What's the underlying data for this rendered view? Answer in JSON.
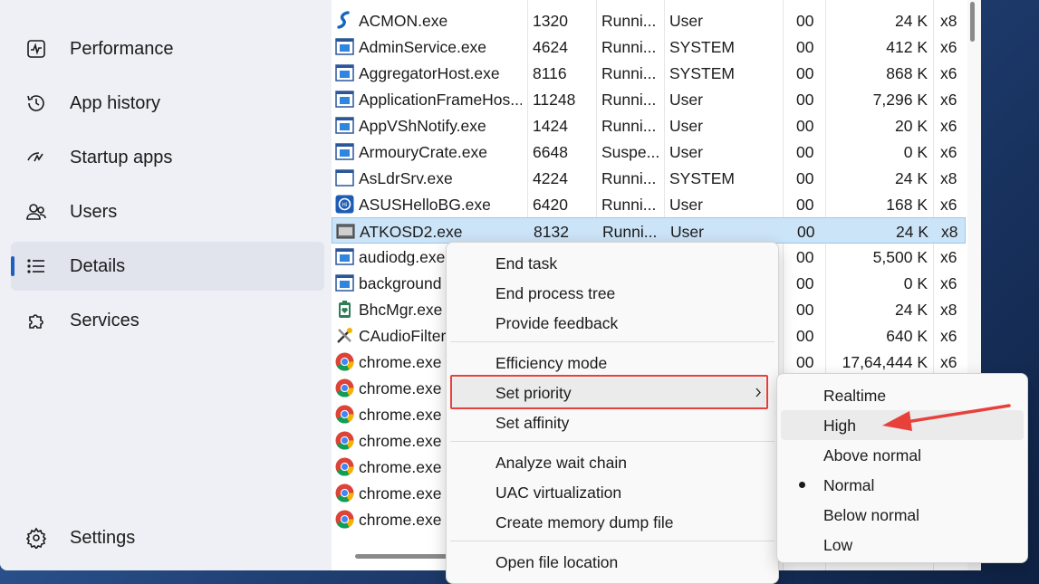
{
  "sidebar": {
    "items": [
      {
        "label": "Performance",
        "icon": "performance-icon",
        "active": false
      },
      {
        "label": "App history",
        "icon": "history-icon",
        "active": false
      },
      {
        "label": "Startup apps",
        "icon": "startup-icon",
        "active": false
      },
      {
        "label": "Users",
        "icon": "users-icon",
        "active": false
      },
      {
        "label": "Details",
        "icon": "list-icon",
        "active": true
      },
      {
        "label": "Services",
        "icon": "puzzle-icon",
        "active": false
      }
    ],
    "settings_label": "Settings"
  },
  "processes": [
    {
      "name": "ACMON.exe",
      "pid": "1320",
      "status": "Runni...",
      "user": "User",
      "cpu": "00",
      "mem": "24 K",
      "arch": "x8",
      "icon": "acmon-icon"
    },
    {
      "name": "AdminService.exe",
      "pid": "4624",
      "status": "Runni...",
      "user": "SYSTEM",
      "cpu": "00",
      "mem": "412 K",
      "arch": "x6",
      "icon": "exe-icon"
    },
    {
      "name": "AggregatorHost.exe",
      "pid": "8116",
      "status": "Runni...",
      "user": "SYSTEM",
      "cpu": "00",
      "mem": "868 K",
      "arch": "x6",
      "icon": "exe-icon"
    },
    {
      "name": "ApplicationFrameHos...",
      "pid": "11248",
      "status": "Runni...",
      "user": "User",
      "cpu": "00",
      "mem": "7,296 K",
      "arch": "x6",
      "icon": "exe-icon"
    },
    {
      "name": "AppVShNotify.exe",
      "pid": "1424",
      "status": "Runni...",
      "user": "User",
      "cpu": "00",
      "mem": "20 K",
      "arch": "x6",
      "icon": "exe-icon"
    },
    {
      "name": "ArmouryCrate.exe",
      "pid": "6648",
      "status": "Suspe...",
      "user": "User",
      "cpu": "00",
      "mem": "0 K",
      "arch": "x6",
      "icon": "exe-icon"
    },
    {
      "name": "AsLdrSrv.exe",
      "pid": "4224",
      "status": "Runni...",
      "user": "SYSTEM",
      "cpu": "00",
      "mem": "24 K",
      "arch": "x8",
      "icon": "window-icon"
    },
    {
      "name": "ASUSHelloBG.exe",
      "pid": "6420",
      "status": "Runni...",
      "user": "User",
      "cpu": "00",
      "mem": "168 K",
      "arch": "x6",
      "icon": "asus-hello-icon"
    },
    {
      "name": "ATKOSD2.exe",
      "pid": "8132",
      "status": "Runni...",
      "user": "User",
      "cpu": "00",
      "mem": "24 K",
      "arch": "x8",
      "icon": "atk-osd-icon",
      "selected": true
    },
    {
      "name": "audiodg.exe",
      "pid": "",
      "status": "",
      "user": "",
      "cpu": "00",
      "mem": "5,500 K",
      "arch": "x6",
      "icon": "exe-icon"
    },
    {
      "name": "background",
      "pid": "",
      "status": "",
      "user": "",
      "cpu": "00",
      "mem": "0 K",
      "arch": "x6",
      "icon": "exe-icon"
    },
    {
      "name": "BhcMgr.exe",
      "pid": "",
      "status": "",
      "user": "",
      "cpu": "00",
      "mem": "24 K",
      "arch": "x8",
      "icon": "battery-icon"
    },
    {
      "name": "CAudioFilter",
      "pid": "",
      "status": "",
      "user": "",
      "cpu": "00",
      "mem": "640 K",
      "arch": "x6",
      "icon": "tools-icon"
    },
    {
      "name": "chrome.exe",
      "pid": "",
      "status": "",
      "user": "",
      "cpu": "00",
      "mem": "17,64,444 K",
      "arch": "x6",
      "icon": "chrome-icon"
    },
    {
      "name": "chrome.exe",
      "pid": "",
      "status": "",
      "user": "",
      "cpu": "",
      "mem": "",
      "arch": "",
      "icon": "chrome-icon"
    },
    {
      "name": "chrome.exe",
      "pid": "",
      "status": "",
      "user": "",
      "cpu": "",
      "mem": "",
      "arch": "",
      "icon": "chrome-icon"
    },
    {
      "name": "chrome.exe",
      "pid": "",
      "status": "",
      "user": "",
      "cpu": "",
      "mem": "",
      "arch": "",
      "icon": "chrome-icon"
    },
    {
      "name": "chrome.exe",
      "pid": "",
      "status": "",
      "user": "",
      "cpu": "",
      "mem": "",
      "arch": "",
      "icon": "chrome-icon"
    },
    {
      "name": "chrome.exe",
      "pid": "",
      "status": "",
      "user": "",
      "cpu": "",
      "mem": "",
      "arch": "",
      "icon": "chrome-icon"
    },
    {
      "name": "chrome.exe",
      "pid": "",
      "status": "",
      "user": "",
      "cpu": "",
      "mem": "",
      "arch": "",
      "icon": "chrome-icon"
    }
  ],
  "context_menu": {
    "groups": [
      [
        "End task",
        "End process tree",
        "Provide feedback"
      ],
      [
        "Efficiency mode",
        "Set priority",
        "Set affinity"
      ],
      [
        "Analyze wait chain",
        "UAC virtualization",
        "Create memory dump file"
      ],
      [
        "Open file location"
      ]
    ],
    "highlighted": "Set priority"
  },
  "priority_menu": {
    "items": [
      "Realtime",
      "High",
      "Above normal",
      "Normal",
      "Below normal",
      "Low"
    ],
    "current": "Normal",
    "hovered": "High"
  },
  "colors": {
    "annotation": "#e8413b",
    "accent": "#1f5fbf",
    "selected_row": "#cce4f7"
  }
}
